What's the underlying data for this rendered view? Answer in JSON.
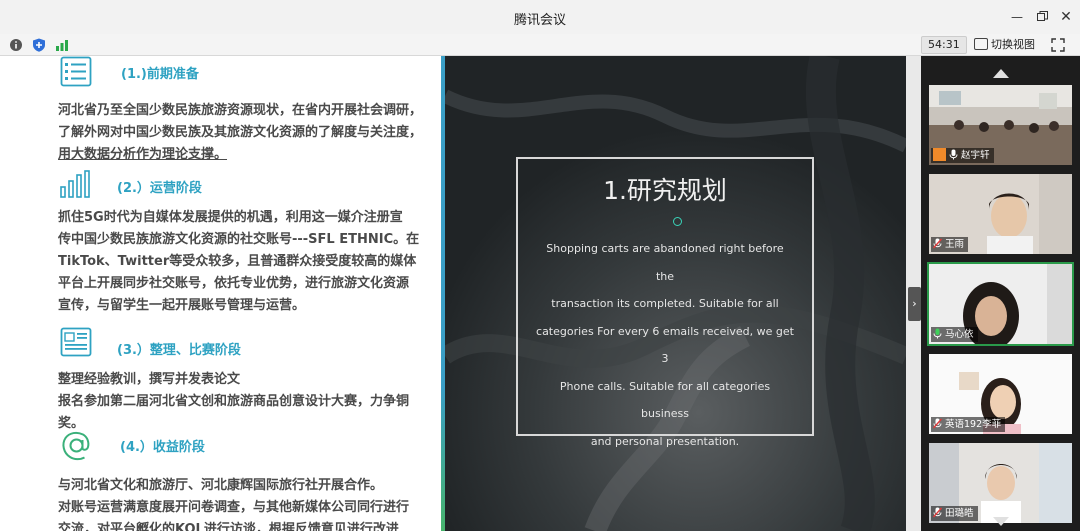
{
  "window": {
    "title": "腾讯会议"
  },
  "toolbar": {
    "timer": "54:31",
    "switch_view_label": "切换视图"
  },
  "document": {
    "sections": [
      {
        "title": "(1.)前期准备",
        "icon": "checklist-icon",
        "lines": [
          "河北省乃至全国少数民族旅游资源现状，在省内开展社会调研，",
          "了解外网对中国少数民族及其旅游文化资源的了解度与关注度，",
          "用大数据分析作为理论支撑。"
        ]
      },
      {
        "title": "(2.）运营阶段",
        "icon": "bar-chart-icon",
        "lines": [
          "抓住5G时代为自媒体发展提供的机遇，利用这一媒介注册宣",
          "传中国少数民族旅游文化资源的社交账号---SFL ETHNIC。在",
          "TikTok、Twitter等受众较多，且普通群众接受度较高的媒体",
          "平台上开展同步社交账号，依托专业优势，进行旅游文化资源",
          "宣传，与留学生一起开展账号管理与运营。"
        ]
      },
      {
        "title": "(3.）整理、比赛阶段",
        "icon": "newspaper-icon",
        "lines": [
          "整理经验教训，撰写并发表论文",
          "报名参加第二届河北省文创和旅游商品创意设计大赛，力争铜",
          "奖。"
        ]
      },
      {
        "title": "(4.）收益阶段",
        "icon": "at-sign-icon",
        "lines": [
          "与河北省文化和旅游厅、河北康辉国际旅行社开展合作。",
          "对账号运营满意度展开问卷调查，与其他新媒体公司同行进行",
          "交流，对平台孵化的KOL进行访谈，根据反馈意见进行改进"
        ]
      }
    ]
  },
  "slide": {
    "title": "1.研究规划",
    "body_lines": [
      "Shopping carts are abandoned right before the",
      "transaction its completed. Suitable for all",
      "categories For every 6 emails received, we get 3",
      "Phone calls. Suitable for all categories business",
      "and personal presentation."
    ]
  },
  "participants": [
    {
      "name": "赵宇轩",
      "mic": "on"
    },
    {
      "name": "王雨",
      "mic": "muted"
    },
    {
      "name": "马心依",
      "mic": "on",
      "active": true
    },
    {
      "name": "英语192李菲",
      "mic": "muted"
    },
    {
      "name": "田璐皓",
      "mic": "muted"
    }
  ],
  "colors": {
    "section_title": "#2ea2c2",
    "speaking_border": "#2a9a4a",
    "slide_accent": "#3ad3b8"
  }
}
